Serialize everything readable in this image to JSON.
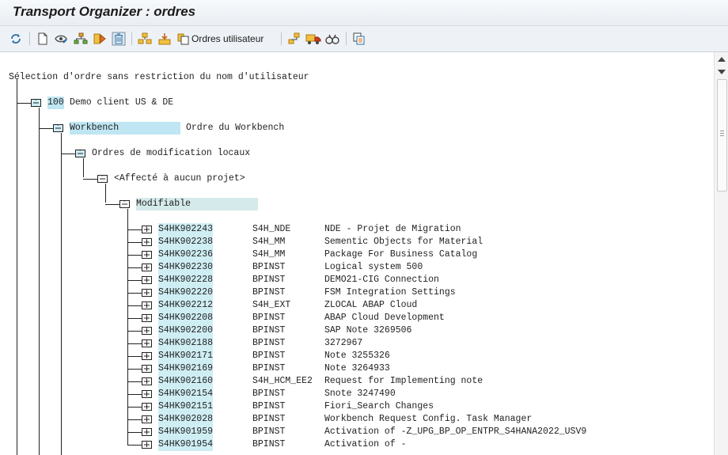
{
  "window": {
    "title": "Transport Organizer : ordres"
  },
  "toolbar": {
    "buttons": [
      {
        "name": "refresh-icon"
      },
      {
        "name": "display-object-icon"
      },
      {
        "name": "display-change-icon"
      },
      {
        "name": "hierarchy-icon"
      },
      {
        "name": "release-icon"
      },
      {
        "name": "delete-icon"
      },
      {
        "name": "add-user-icon"
      },
      {
        "name": "import-icon"
      },
      {
        "name": "order-users-icon"
      },
      {
        "name": "tree-config-icon"
      },
      {
        "name": "transport-truck-icon"
      },
      {
        "name": "find-icon"
      },
      {
        "name": "copy-icon"
      }
    ],
    "order_users_label": "Ordres utilisateur"
  },
  "tree": {
    "header": "Sélection d'ordre sans restriction du nom d'utilisateur",
    "client_number": "100",
    "client_label": "Demo client US & DE",
    "workbench_label": "Workbench",
    "workbench_desc": "Ordre du Workbench",
    "local_changes_label": "Ordres de modification locaux",
    "no_project_label": "<Affecté à aucun projet>",
    "modifiable_label": "Modifiable",
    "requests": [
      {
        "id": "S4HK902243",
        "owner": "S4H_NDE",
        "desc": "NDE - Projet de Migration"
      },
      {
        "id": "S4HK902238",
        "owner": "S4H_MM",
        "desc": "Sementic Objects for Material"
      },
      {
        "id": "S4HK902236",
        "owner": "S4H_MM",
        "desc": "Package For Business Catalog"
      },
      {
        "id": "S4HK902230",
        "owner": "BPINST",
        "desc": "Logical system 500"
      },
      {
        "id": "S4HK902228",
        "owner": "BPINST",
        "desc": "DEMO21-CIG Connection"
      },
      {
        "id": "S4HK902220",
        "owner": "BPINST",
        "desc": "FSM Integration Settings"
      },
      {
        "id": "S4HK902212",
        "owner": "S4H_EXT",
        "desc": "ZLOCAL ABAP Cloud"
      },
      {
        "id": "S4HK902208",
        "owner": "BPINST",
        "desc": "ABAP Cloud Development"
      },
      {
        "id": "S4HK902200",
        "owner": "BPINST",
        "desc": "SAP Note 3269506"
      },
      {
        "id": "S4HK902188",
        "owner": "BPINST",
        "desc": "3272967"
      },
      {
        "id": "S4HK902171",
        "owner": "BPINST",
        "desc": "Note 3255326"
      },
      {
        "id": "S4HK902169",
        "owner": "BPINST",
        "desc": "Note 3264933"
      },
      {
        "id": "S4HK902160",
        "owner": "S4H_HCM_EE2",
        "desc": "Request for Implementing note"
      },
      {
        "id": "S4HK902154",
        "owner": "BPINST",
        "desc": "Snote 3247490"
      },
      {
        "id": "S4HK902151",
        "owner": "BPINST",
        "desc": "Fiori_Search Changes"
      },
      {
        "id": "S4HK902028",
        "owner": "BPINST",
        "desc": "Workbench Request Config. Task Manager"
      },
      {
        "id": "S4HK901959",
        "owner": "BPINST",
        "desc": "Activation of -Z_UPG_BP_OP_ENTPR_S4HANA2022_USV9"
      },
      {
        "id": "S4HK901954",
        "owner": "BPINST",
        "desc": "Activation of -"
      }
    ]
  }
}
